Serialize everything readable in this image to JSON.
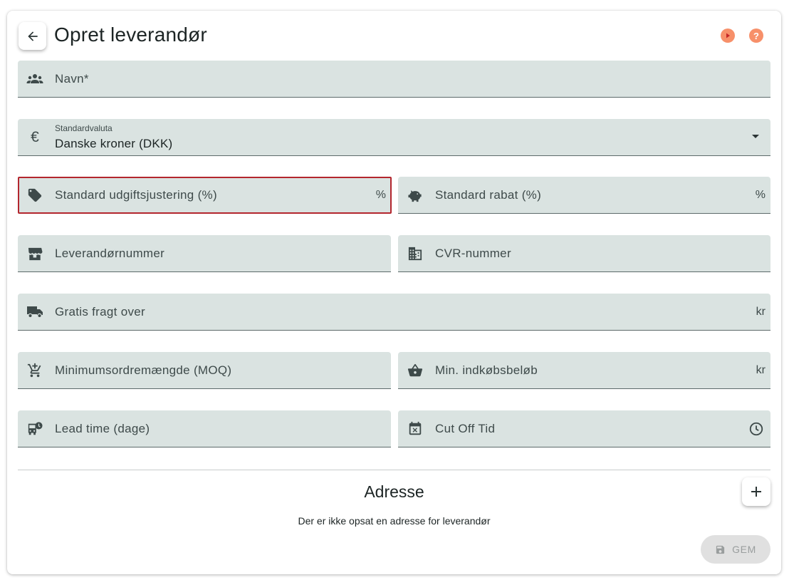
{
  "header": {
    "title": "Opret leverandør"
  },
  "fields": {
    "name": {
      "label": "Navn*"
    },
    "currency": {
      "label": "Standardvaluta",
      "value": "Danske kroner (DKK)"
    },
    "cost_adjustment": {
      "label": "Standard udgiftsjustering (%)",
      "suffix": "%"
    },
    "discount": {
      "label": "Standard rabat (%)",
      "suffix": "%"
    },
    "supplier_number": {
      "label": "Leverandørnummer"
    },
    "cvr_number": {
      "label": "CVR-nummer"
    },
    "free_shipping": {
      "label": "Gratis fragt over",
      "suffix": "kr"
    },
    "moq": {
      "label": "Minimumsordremængde (MOQ)"
    },
    "min_purchase": {
      "label": "Min. indkøbsbeløb",
      "suffix": "kr"
    },
    "lead_time": {
      "label": "Lead time (dage)"
    },
    "cut_off": {
      "label": "Cut Off Tid"
    }
  },
  "address": {
    "title": "Adresse",
    "empty_text": "Der er ikke opsat en adresse for leverandør"
  },
  "actions": {
    "save_label": "GEM"
  },
  "colors": {
    "accent": "#f7906a",
    "field_bg": "#dae3e1",
    "error": "#b3262e"
  }
}
